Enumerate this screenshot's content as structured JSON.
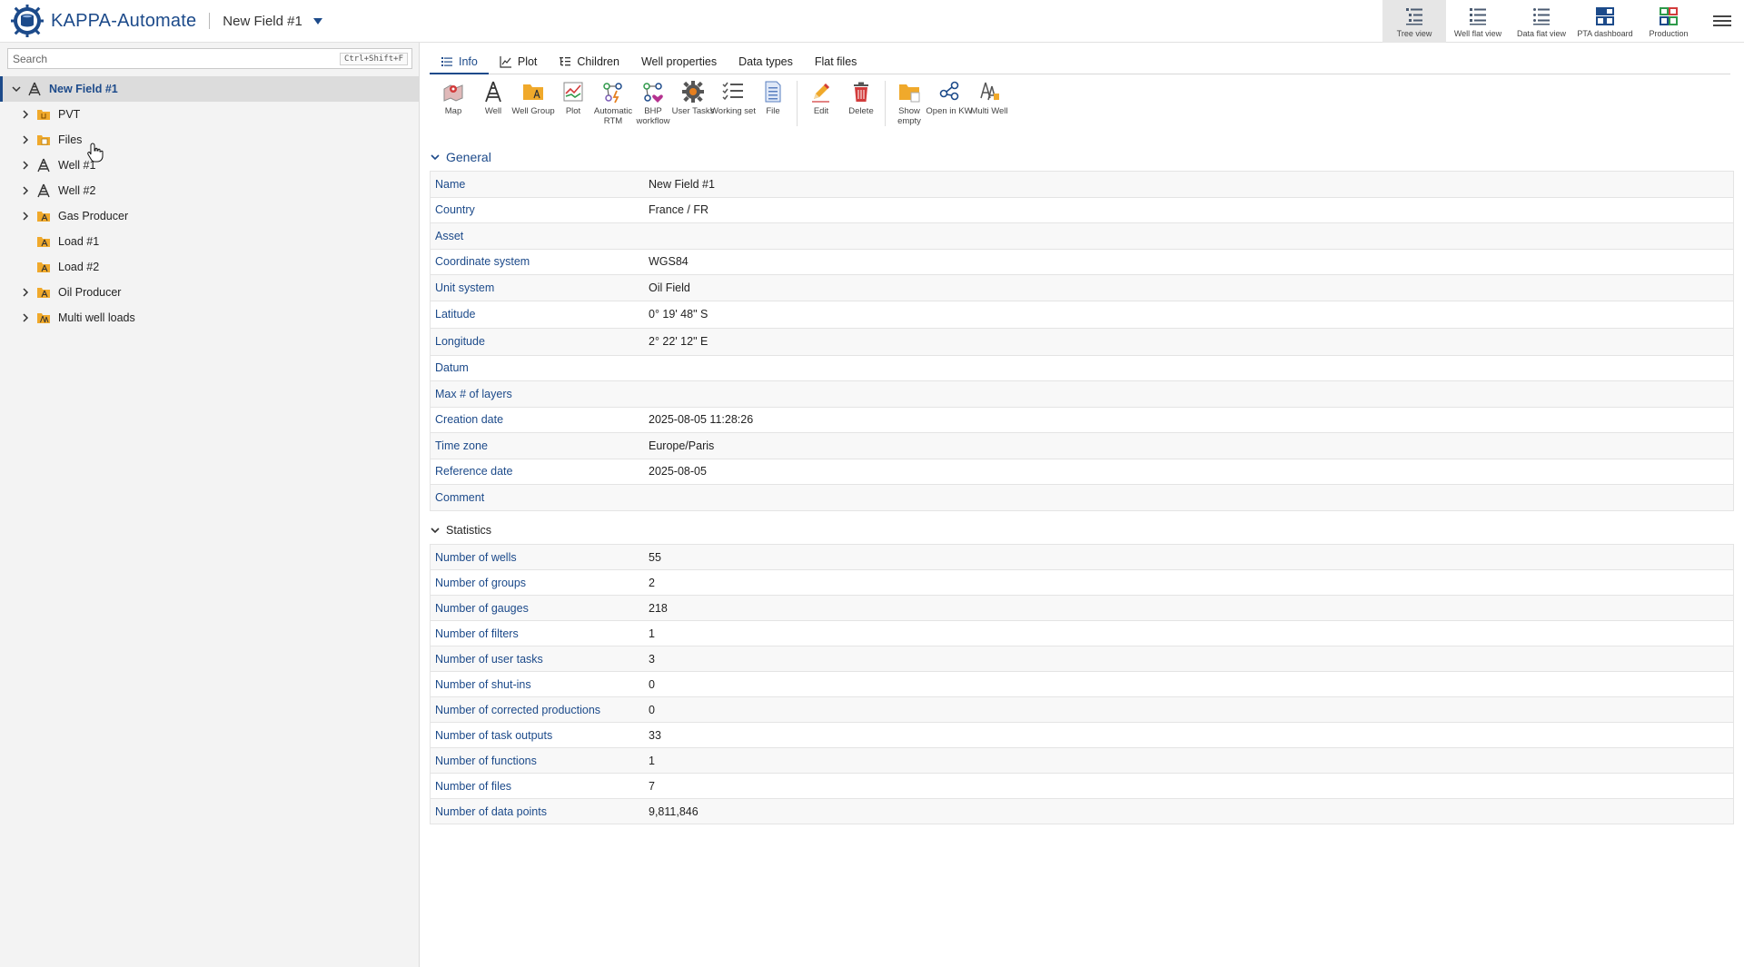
{
  "header": {
    "app_name": "KAPPA-Automate",
    "field_title": "New Field #1",
    "views": [
      {
        "label": "Tree view",
        "icon": "tree-view-icon",
        "active": true
      },
      {
        "label": "Well flat view",
        "icon": "well-flat-view-icon",
        "active": false
      },
      {
        "label": "Data flat view",
        "icon": "data-flat-view-icon",
        "active": false
      },
      {
        "label": "PTA dashboard",
        "icon": "pta-dashboard-icon",
        "active": false
      },
      {
        "label": "Production",
        "icon": "production-icon",
        "active": false
      }
    ]
  },
  "search": {
    "placeholder": "Search",
    "value": "",
    "shortcut": "Ctrl+Shift+F"
  },
  "tree": {
    "root": {
      "label": "New Field #1",
      "icon": "field-icon"
    },
    "items": [
      {
        "label": "PVT",
        "icon": "pvt-folder-icon",
        "expandable": true
      },
      {
        "label": "Files",
        "icon": "files-folder-icon",
        "expandable": true
      },
      {
        "label": "Well #1",
        "icon": "well-icon",
        "expandable": true
      },
      {
        "label": "Well #2",
        "icon": "well-icon",
        "expandable": true
      },
      {
        "label": "Gas Producer",
        "icon": "well-group-folder-icon",
        "expandable": true
      },
      {
        "label": "Load #1",
        "icon": "well-group-folder-icon",
        "expandable": false
      },
      {
        "label": "Load #2",
        "icon": "well-group-folder-icon",
        "expandable": false
      },
      {
        "label": "Oil Producer",
        "icon": "well-group-folder-icon",
        "expandable": true
      },
      {
        "label": "Multi well loads",
        "icon": "multi-well-folder-icon",
        "expandable": true
      }
    ]
  },
  "tabs": [
    {
      "label": "Info",
      "active": true
    },
    {
      "label": "Plot",
      "active": false
    },
    {
      "label": "Children",
      "active": false
    },
    {
      "label": "Well properties",
      "active": false
    },
    {
      "label": "Data types",
      "active": false
    },
    {
      "label": "Flat files",
      "active": false
    }
  ],
  "toolbar": {
    "map": "Map",
    "well": "Well",
    "well_group": "Well Group",
    "plot": "Plot",
    "automatic_rtm": "Automatic RTM",
    "bhp_workflow": "BHP workflow",
    "user_tasks": "User Tasks",
    "working_set": "Working set",
    "file": "File",
    "edit": "Edit",
    "delete": "Delete",
    "show_empty": "Show empty",
    "open_in_kw": "Open in KW",
    "multi_well": "Multi Well"
  },
  "general": {
    "title": "General",
    "rows": [
      {
        "name": "Name",
        "value": "New Field #1"
      },
      {
        "name": "Country",
        "value": "France / FR"
      },
      {
        "name": "Asset",
        "value": ""
      },
      {
        "name": "Coordinate system",
        "value": "WGS84"
      },
      {
        "name": "Unit system",
        "value": "Oil Field"
      },
      {
        "name": "Latitude",
        "value": "0° 19' 48\" S"
      },
      {
        "name": "Longitude",
        "value": "2° 22' 12\" E"
      },
      {
        "name": "Datum",
        "value": ""
      },
      {
        "name": "Max # of layers",
        "value": ""
      },
      {
        "name": "Creation date",
        "value": "2025-08-05 11:28:26"
      },
      {
        "name": "Time zone",
        "value": "Europe/Paris"
      },
      {
        "name": "Reference date",
        "value": "2025-08-05"
      },
      {
        "name": "Comment",
        "value": ""
      }
    ]
  },
  "statistics": {
    "title": "Statistics",
    "rows": [
      {
        "name": "Number of wells",
        "value": "55"
      },
      {
        "name": "Number of groups",
        "value": "2"
      },
      {
        "name": "Number of gauges",
        "value": "218"
      },
      {
        "name": "Number of filters",
        "value": "1"
      },
      {
        "name": "Number of user tasks",
        "value": "3"
      },
      {
        "name": "Number of shut-ins",
        "value": "0"
      },
      {
        "name": "Number of corrected productions",
        "value": "0"
      },
      {
        "name": "Number of task outputs",
        "value": "33"
      },
      {
        "name": "Number of functions",
        "value": "1"
      },
      {
        "name": "Number of files",
        "value": "7"
      },
      {
        "name": "Number of data points",
        "value": "9,811,846"
      }
    ]
  },
  "colors": {
    "brand": "#1c4a8a",
    "folder": "#f0a92b",
    "selection": "#dcdcdc"
  }
}
